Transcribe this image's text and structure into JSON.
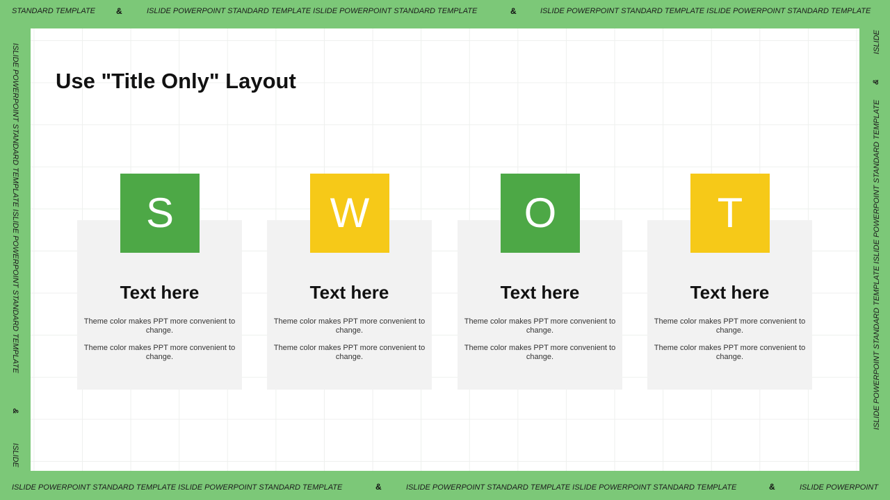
{
  "colors": {
    "frame_green": "#7cc878",
    "swot_green": "#4da846",
    "swot_yellow": "#f6c918",
    "card_gray": "#f2f2f2"
  },
  "frame": {
    "top_left": "STANDARD TEMPLATE",
    "top_amp1": "&",
    "top_mid": "ISLIDE POWERPOINT STANDARD TEMPLATE ISLIDE POWERPOINT STANDARD TEMPLATE",
    "top_amp2": "&",
    "top_right": "ISLIDE POWERPOINT STANDARD TEMPLATE ISLIDE POWERPOINT STANDARD TEMPLATE",
    "bottom_left": "ISLIDE POWERPOINT STANDARD TEMPLATE ISLIDE POWERPOINT STANDARD TEMPLATE",
    "bottom_amp1": "&",
    "bottom_mid": "ISLIDE POWERPOINT STANDARD TEMPLATE ISLIDE POWERPOINT STANDARD TEMPLATE",
    "bottom_amp2": "&",
    "bottom_right": "ISLIDE POWERPOINT",
    "left_long": "ISLIDE POWERPOINT STANDARD TEMPLATE ISLIDE POWERPOINT STANDARD TEMPLATE",
    "left_amp": "&",
    "left_short": "ISLIDE",
    "right_short": "ISLIDE",
    "right_amp": "&",
    "right_long": "ISLIDE POWERPOINT STANDARD TEMPLATE ISLIDE POWERPOINT STANDARD TEMPLATE"
  },
  "slide": {
    "title": "Use \"Title Only\" Layout",
    "cards": [
      {
        "letter": "S",
        "heading": "Text here",
        "body1": "Theme  color makes PPT more convenient  to change.",
        "body2": "Theme  color makes PPT more convenient  to change."
      },
      {
        "letter": "W",
        "heading": "Text here",
        "body1": "Theme  color makes PPT more convenient  to change.",
        "body2": "Theme  color makes PPT more convenient  to change."
      },
      {
        "letter": "O",
        "heading": "Text here",
        "body1": "Theme  color makes PPT more convenient  to change.",
        "body2": "Theme  color makes PPT more convenient  to change."
      },
      {
        "letter": "T",
        "heading": "Text here",
        "body1": "Theme  color makes PPT more convenient  to change.",
        "body2": "Theme  color makes PPT more convenient  to change."
      }
    ]
  }
}
